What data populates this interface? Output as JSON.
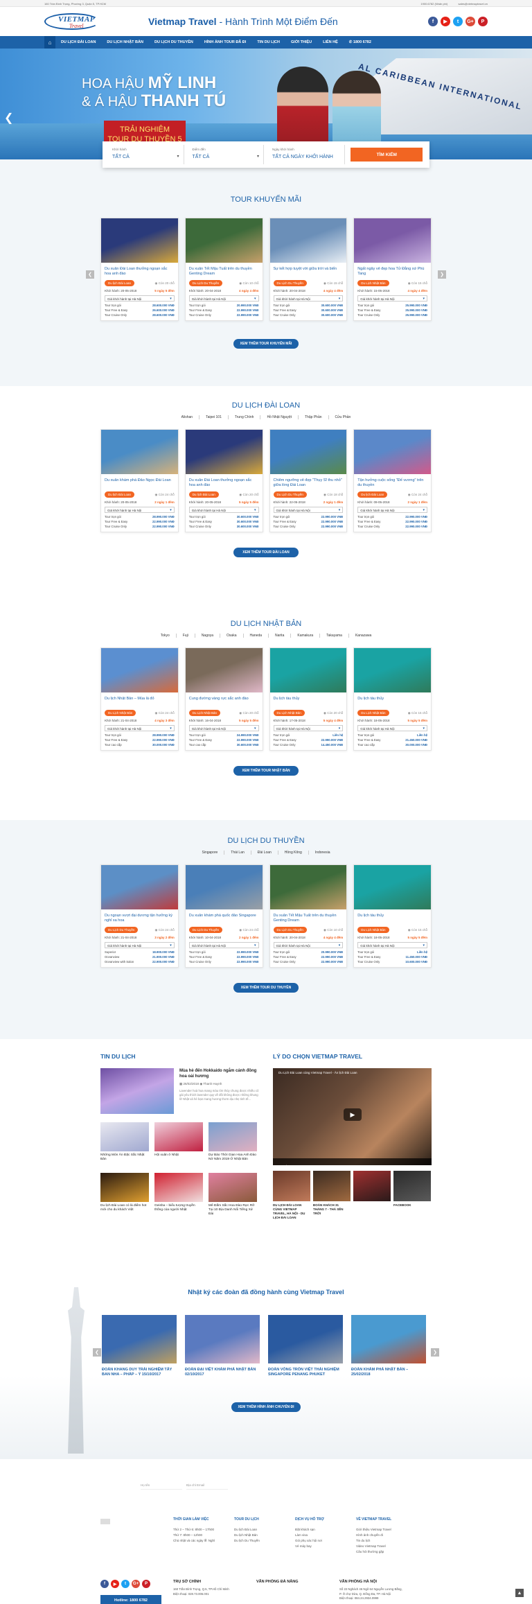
{
  "topbar": {
    "address": "160 Trần Bình Trọng, Phường 3, Quận 5, TP.HCM",
    "phone": "1900.6782 (Nhấn phí)",
    "email": "sales@vietmaptravel.vn"
  },
  "header": {
    "logo_main": "VIETMAP",
    "logo_sub": "Travel",
    "slogan_brand": "Vietmap Travel",
    "slogan_rest": " - Hành Trình Một Điểm Đến",
    "socials": [
      "f",
      "▶",
      "t",
      "G+",
      "P"
    ]
  },
  "nav": {
    "items": [
      "DU LỊCH ĐÀI LOAN",
      "DU LỊCH NHẬT BẢN",
      "DU LỊCH DU THUYỀN",
      "HÌNH ẢNH TOUR ĐÃ ĐI",
      "TIN DU LỊCH",
      "GIỚI THIỆU",
      "LIÊN HỆ",
      "1800 6782"
    ]
  },
  "banner": {
    "line1_pre": "HOA HẬU ",
    "line1_bold": "MỸ LINH",
    "line2_pre": "& Á HẬU ",
    "line2_bold": "THANH TÚ",
    "tag_line1": "TRẢI NGHIỆM",
    "tag_line2": "TOUR DU THUYỀN 5 SAO",
    "ship_text": "AL CARIBBEAN INTERNATIONAL"
  },
  "search": {
    "f1_label": "Khởi hành",
    "f1_value": "TẤT CẢ",
    "f2_label": "Điểm đến",
    "f2_value": "TẤT CẢ",
    "f3_label": "Ngày khởi hành",
    "f3_value": "TẤT CẢ NGÀY KHỞI HÀNH",
    "button": "TÌM KIẾM"
  },
  "promo": {
    "title": "TOUR KHUYẾN MÃI",
    "more": "XEM THÊM TOUR KHUYẾN MÃI",
    "cards": [
      {
        "title": "Du xuân Đài Loan thưởng ngoạn sắc hoa anh đào",
        "badge": "Du lịch Đài Loan",
        "remain": "Còn 20 chỗ",
        "date": "Khởi hành: 20-05-2018",
        "dur": "5 ngày 5 đêm",
        "sel": "Giá khởi hành tại Hà Nội",
        "prices": [
          [
            "Tour trọn gói",
            "28.600.000 VNĐ"
          ],
          [
            "Tour Free & Easy",
            "26.600.000 VNĐ"
          ],
          [
            "Tour Cruise Only",
            "28.600.000 VNĐ"
          ]
        ],
        "c1": "#2a3a7a",
        "c2": "#d9a93a"
      },
      {
        "title": "Du xuân Tết Mậu Tuất trên du thuyền Genting Dream",
        "badge": "Du Lịch Du Thuyền",
        "remain": "Còn 10 chỗ",
        "date": "Khởi hành: 20-04-2018",
        "dur": "4 ngày 4 đêm",
        "sel": "Giá khởi hành tại Hà Nội",
        "prices": [
          [
            "Tour trọn gói",
            "20.990.000 VNĐ"
          ],
          [
            "Tour Free & Easy",
            "22.990.000 VNĐ"
          ],
          [
            "Tour Cruise Only",
            "22.990.000 VNĐ"
          ]
        ],
        "c1": "#3d6a3a",
        "c2": "#c7a06a"
      },
      {
        "title": "Sự kết hợp tuyệt vời giữa trời và biển",
        "badge": "Du Lịch Du Thuyền",
        "remain": "Còn 15 chỗ",
        "date": "Khởi hành: 20-04-2018",
        "dur": "4 ngày 4 đêm",
        "sel": "Giá khởi hành tại Hà Nội",
        "prices": [
          [
            "Tour trọn gói",
            "30.600.000 VNĐ"
          ],
          [
            "Tour Free & Easy",
            "30.600.000 VNĐ"
          ],
          [
            "Tour Cruise Only",
            "30.600.000 VNĐ"
          ]
        ],
        "c1": "#6b8fb8",
        "c2": "#e8eef4"
      },
      {
        "title": "Ngất ngây vẻ đẹp hoa Tử Đằng xứ Phù Tang",
        "badge": "Du Lịch Nhật Bản",
        "remain": "Còn 15 chỗ",
        "date": "Khởi hành: 15-05-2018",
        "dur": "4 ngày 4 đêm",
        "sel": "Giá khởi hành tại Hà Nội",
        "prices": [
          [
            "Tour trọn gói",
            "25.990.000 VNĐ"
          ],
          [
            "Tour Free & Easy",
            "25.990.000 VNĐ"
          ],
          [
            "Tour Cruise Only",
            "25.990.000 VNĐ"
          ]
        ],
        "c1": "#7b5aa6",
        "c2": "#c9b3e0"
      }
    ]
  },
  "taiwan": {
    "title": "DU LỊCH ĐÀI LOAN",
    "tabs": [
      "Alishan",
      "Taipei 101",
      "Trung Chính",
      "Hồ Nhật Nguyệt",
      "Thập Phần",
      "Cửu Phần"
    ],
    "more": "XEM THÊM TOUR ĐÀI LOAN",
    "cards": [
      {
        "title": "Du xuân khám phá Đảo Ngọc Đài Loan",
        "badge": "Du lịch Đài Loan",
        "remain": "Còn 24 chỗ",
        "date": "Khởi hành: 20-05-2018",
        "dur": "2 ngày 1 đêm",
        "sel": "Giá khởi hành tại Hà Nội",
        "prices": [
          [
            "Tour trọn gói",
            "28.990.000 VNĐ"
          ],
          [
            "Tour Free & Easy",
            "22.990.000 VNĐ"
          ],
          [
            "Tour Cruise Only",
            "22.990.000 VNĐ"
          ]
        ],
        "c1": "#4a8cc6",
        "c2": "#d7b27a"
      },
      {
        "title": "Du xuân Đài Loan thưởng ngoạn sắc hoa anh đào",
        "badge": "Du lịch Đài Loan",
        "remain": "Còn 20 chỗ",
        "date": "Khởi hành: 20-05-2018",
        "dur": "5 ngày 5 đêm",
        "sel": "Giá khởi hành tại Hà Nội",
        "prices": [
          [
            "Tour trọn gói",
            "30.600.000 VNĐ"
          ],
          [
            "Tour Free & Easy",
            "30.600.000 VNĐ"
          ],
          [
            "Tour Cruise Only",
            "30.600.000 VNĐ"
          ]
        ],
        "c1": "#2a3a7a",
        "c2": "#d9a93a"
      },
      {
        "title": "Chiêm ngưỡng vẻ đẹp \"Thụy Sĩ thu nhỏ\" giữa lòng Đài Loan",
        "badge": "Du Lịch Du Thuyền",
        "remain": "Còn 18 chỗ",
        "date": "Khởi hành: 22-05-2018",
        "dur": "2 ngày 1 đêm",
        "sel": "Giá khởi hành tại Hà Nội",
        "prices": [
          [
            "Tour trọn gói",
            "22.990.000 VNĐ"
          ],
          [
            "Tour Free & Easy",
            "22.990.000 VNĐ"
          ],
          [
            "Tour Cruise Only",
            "22.990.000 VNĐ"
          ]
        ],
        "c1": "#3f7fc0",
        "c2": "#5a8a4a"
      },
      {
        "title": "Tận hưởng cuộc sống \"Đế vương\" trên du thuyền",
        "badge": "Du lịch Đài Loan",
        "remain": "Còn 24 chỗ",
        "date": "Khởi hành: 09-05-2018",
        "dur": "2 ngày 1 đêm",
        "sel": "Giá khởi hành tại Hà Nội",
        "prices": [
          [
            "Tour trọn gói",
            "22.990.000 VNĐ"
          ],
          [
            "Tour Free & Easy",
            "22.990.000 VNĐ"
          ],
          [
            "Tour Cruise Only",
            "22.990.000 VNĐ"
          ]
        ],
        "c1": "#5b88c9",
        "c2": "#d25a8a"
      }
    ]
  },
  "japan": {
    "title": "DU LỊCH NHẬT BẢN",
    "tabs": [
      "Tokyo",
      "Fuji",
      "Nagoya",
      "Osaka",
      "Haneda",
      "Narita",
      "Kamakura",
      "Takayama",
      "Kanazawa"
    ],
    "more": "XEM THÊM TOUR NHẬT BẢN",
    "cards": [
      {
        "title": "Du lịch Nhật Bản – Mùa lá đỏ",
        "badge": "Du Lịch Nhật Bản",
        "remain": "Còn 24 chỗ",
        "date": "Khởi hành: 21-04-2018",
        "dur": "4 ngày 3 đêm",
        "sel": "Giá khởi hành tại Hà Nội",
        "prices": [
          [
            "Tour trọn gói",
            "28.990.000 VNĐ"
          ],
          [
            "Tour Free & Easy",
            "22.990.000 VNĐ"
          ],
          [
            "Tour cao cấp",
            "30.000.000 VNĐ"
          ]
        ],
        "c1": "#5b8fd0",
        "c2": "#d86a3a"
      },
      {
        "title": "Cung đường vàng rực sắc anh đào",
        "badge": "Du Lịch Nhật Bản",
        "remain": "Còn 20 chỗ",
        "date": "Khởi hành: 16-04-2018",
        "dur": "5 ngày 5 đêm",
        "sel": "Giá khởi hành tại Hà Nội",
        "prices": [
          [
            "Tour trọn gói",
            "24.990.000 VNĐ"
          ],
          [
            "Tour Free & Easy",
            "22.990.000 VNĐ"
          ],
          [
            "Tour cao cấp",
            "30.600.000 VNĐ"
          ]
        ],
        "c1": "#7a6a5a",
        "c2": "#e0b8c8"
      },
      {
        "title": "Du lịch tàu thủy",
        "badge": "Du Lịch Nhật Bản",
        "remain": "Còn 20 chỗ",
        "date": "Khởi hành: 17-05-2018",
        "dur": "5 ngày 4 đêm",
        "sel": "Giá khởi hành tại Hà Nội",
        "prices": [
          [
            "Tour trọn gói",
            "Liên hệ"
          ],
          [
            "Tour Free & Easy",
            "22.990.000 VNĐ"
          ],
          [
            "Tour Cruise Only",
            "14.450.000 VNĐ"
          ]
        ],
        "c1": "#1aa3a3",
        "c2": "#2f7a5a"
      },
      {
        "title": "Du lịch tàu thủy",
        "badge": "Du Lịch Nhật Bản",
        "remain": "Còn 15 chỗ",
        "date": "Khởi hành: 18-05-2018",
        "dur": "5 ngày 5 đêm",
        "sel": "Giá khởi hành tại Hà Nội",
        "prices": [
          [
            "Tour trọn gói",
            "Liên hệ"
          ],
          [
            "Tour Free & Easy",
            "21.450.000 VNĐ"
          ],
          [
            "Tour cao cấp",
            "30.000.000 VNĐ"
          ]
        ],
        "c1": "#1aa3a3",
        "c2": "#2f7a5a"
      }
    ]
  },
  "cruise": {
    "title": "DU LỊCH DU THUYỀN",
    "tabs": [
      "Singapore",
      "Thái Lan",
      "Đài Loan",
      "Hồng Kông",
      "Indonesia"
    ],
    "more": "XEM THÊM TOUR DU THUYỀN",
    "cards": [
      {
        "title": "Du ngoạn vượt đại dương tận hưởng kỳ nghỉ xa hoa",
        "badge": "Du Lịch Du Thuyền",
        "remain": "Còn 24 chỗ",
        "date": "Khởi hành: 21-04-2018",
        "dur": "3 ngày 2 đêm",
        "sel": "Giá khởi hành tại Hà Nội",
        "prices": [
          [
            "Superior",
            "18.900.000 VNĐ"
          ],
          [
            "Oceanview",
            "21.900.000 VNĐ"
          ],
          [
            "Oceanview with Salon",
            "22.900.000 VNĐ"
          ]
        ],
        "c1": "#5c8fc6",
        "c2": "#c03a3a"
      },
      {
        "title": "Du xuân khám phá quốc đảo Singapore",
        "badge": "Du Lịch Du Thuyền",
        "remain": "Còn 24 chỗ",
        "date": "Khởi hành: 10-04-2018",
        "dur": "2 ngày 1 đêm",
        "sel": "Giá khởi hành tại Hà Nội",
        "prices": [
          [
            "Tour trọn gói",
            "22.990.000 VNĐ"
          ],
          [
            "Tour Free & Easy",
            "22.990.000 VNĐ"
          ],
          [
            "Tour Cruise Only",
            "22.990.000 VNĐ"
          ]
        ],
        "c1": "#4a7fb8",
        "c2": "#9aa0a6"
      },
      {
        "title": "Du xuân Tết Mậu Tuất trên du thuyền Genting Dream",
        "badge": "Du Lịch Du Thuyền",
        "remain": "Còn 10 chỗ",
        "date": "Khởi hành: 20-04-2018",
        "dur": "4 ngày 4 đêm",
        "sel": "Giá khởi hành tại Hà Nội",
        "prices": [
          [
            "Tour trọn gói",
            "20.990.000 VNĐ"
          ],
          [
            "Tour Free & Easy",
            "22.990.000 VNĐ"
          ],
          [
            "Tour Cruise Only",
            "22.990.000 VNĐ"
          ]
        ],
        "c1": "#3d6a3a",
        "c2": "#c7a06a"
      },
      {
        "title": "Du lịch tàu thủy",
        "badge": "Du Lịch Nhật Bản",
        "remain": "Còn 15 chỗ",
        "date": "Khởi hành: 18-05-2018",
        "dur": "5 ngày 5 đêm",
        "sel": "Giá khởi hành tại Hà Nội",
        "prices": [
          [
            "Tour trọn gói",
            "Liên hệ"
          ],
          [
            "Tour Free & Easy",
            "11.450.000 VNĐ"
          ],
          [
            "Tour Cruise Only",
            "10.600.000 VNĐ"
          ]
        ],
        "c1": "#1aa3a3",
        "c2": "#2f7a5a"
      }
    ]
  },
  "news": {
    "title": "TIN DU LỊCH",
    "featured": {
      "title": "Mùa hè đến Hokkaido ngắm cánh đồng hoa oải hương",
      "date": "26/02/2018",
      "author": "Thanh Huynh",
      "desc": "Lavender hoà hoa mang màu tím thủy chung được nhiều cô gái yêu thích lavender quy về đồi không được những khung lỡ Nhật và hè bạn mang hương thơm dịu nhẹ tinh tế..."
    },
    "items": [
      {
        "title": "Những Món Ăn Đặc Sắc Nhật Bản",
        "c1": "#e8e8f0",
        "c2": "#a0a8d0"
      },
      {
        "title": "Hội xuân ở Nhật",
        "c1": "#f0d0dc",
        "c2": "#c02040"
      },
      {
        "title": "Dự Báo Thời Gian Hoa Anh Đào Nở Năm 2019 Ở Nhật Bản",
        "c1": "#7aa0d0",
        "c2": "#e2b0c0"
      },
      {
        "title": "Du lịch Đài Loan có là điểm hot mới cho du khách Việt",
        "c1": "#2a1a10",
        "c2": "#e0a030"
      },
      {
        "title": "Geisha – biểu tượng truyền thống của người Nhật",
        "c1": "#d02030",
        "c2": "#f0e0e0"
      },
      {
        "title": "Mê Đắm Sắc Hoa Đào Rực Rỡ Tại 10 Địa Danh Nổi Tiếng Xứ Đài",
        "c1": "#e080a0",
        "c2": "#8a5a3a"
      }
    ]
  },
  "why": {
    "title": "LÝ DO CHỌN VIETMAP TRAVEL",
    "video_title": "Du Lịch Đài Loan cùng Vietmap Travel - Ăn lịch Đài Loan",
    "time": "00:00 / 01:37",
    "thumbs": [
      {
        "title": "DU LỊCH ĐÀI LOAN CÙNG VIETMAP TRAVEL, HÀ NỘI - DU LỊCH ĐÀI LOAN",
        "c1": "#6a3a2a",
        "c2": "#c07a5a"
      },
      {
        "title": "ĐOÀN KHÁCH 31 THÁNG 7 - THÁ SẼN TRỜI",
        "c1": "#3a2a20",
        "c2": "#a06a40"
      },
      {
        "title": "",
        "c1": "#a03030",
        "c2": "#2a1a1a"
      },
      {
        "title": "FACEBOOK",
        "c1": "#2a2a2a",
        "c2": "#5a5a5a"
      }
    ]
  },
  "journal": {
    "title": "Nhật ký các đoàn đã đồng hành cùng Vietmap Travel",
    "more": "XEM THÊM HÌNH ẢNH CHUYẾN ĐI",
    "items": [
      {
        "title": "ĐOÀN KHANG DUY TRẢI NGHIỆM TÂY BAN NHA – PHÁP – Ý 15/10/2017",
        "c1": "#3a6ab0",
        "c2": "#c0a060"
      },
      {
        "title": "ĐOÀN ĐẠI VIỆT KHÁM PHÁ NHẬT BẢN 02/10/2017",
        "c1": "#5a7ac0",
        "c2": "#e2b8c8"
      },
      {
        "title": "ĐOÀN VỎNG TRÒN VIỆT THẢI NGHIỆM SINGAPORE PENANG PHUKET",
        "c1": "#2a5aa0",
        "c2": "#9aa0aa"
      },
      {
        "title": "ĐOÀN KHÁM PHÁ NHẬT BẢN – 25/02/2018",
        "c1": "#4a9ad0",
        "c2": "#c05030"
      }
    ]
  },
  "subscribe": {
    "name_ph": "Họ tên",
    "email_ph": "Địa chỉ Email"
  },
  "footer": {
    "cols": [
      {
        "title": "THỜI GIAN LÀM VIỆC",
        "lines": [
          "Thứ 2 – Thứ 6: 8h00 – 17h00",
          "Thứ 7: 8h00 – 12h00",
          "Chủ nhật và các ngày lễ: Nghỉ"
        ]
      },
      {
        "title": "TOUR DU LỊCH",
        "lines": [
          "Du lịch Đài Loan",
          "Du lịch Nhật Bản",
          "Du lịch Du Thuyền"
        ]
      },
      {
        "title": "DỊCH VỤ HỖ TRỢ",
        "lines": [
          "Đặt khách sạn",
          "Làm visa",
          "Gói phụ xác hội nơi",
          "Vé máy bay"
        ]
      },
      {
        "title": "VỀ VIETMAP TRAVEL",
        "lines": [
          "Giới thiệu Vietmap Travel",
          "Hình ảnh chuyến đi",
          "Tin du lịch",
          "Video Vietmap Travel",
          "Câu hỏi thường gặp"
        ]
      }
    ],
    "hotline": "Hotline: 1800 6782",
    "offices": [
      {
        "title": "TRỤ SỞ CHÍNH",
        "lines": [
          "160 Trần Bình Trọng, Q.5, TP.Hồ Chí Minh",
          "Điện thoại: 028.73.006.001"
        ]
      },
      {
        "title": "VĂN PHÒNG ĐÀ NẴNG",
        "lines": [
          ""
        ]
      },
      {
        "title": "VĂN PHÒNG HÀ NỘI",
        "lines": [
          "Số 22 Nghách 46 Ngõ 64 Nguyễn Lương Bằng,",
          "P. Ô chợ Dừa, Q. Đống Đa, TP. Hà Nội",
          "Điện thoại: 084.24.2934.0999"
        ]
      }
    ]
  },
  "colors": {
    "primary": "#1d62a8",
    "accent": "#f26522"
  }
}
